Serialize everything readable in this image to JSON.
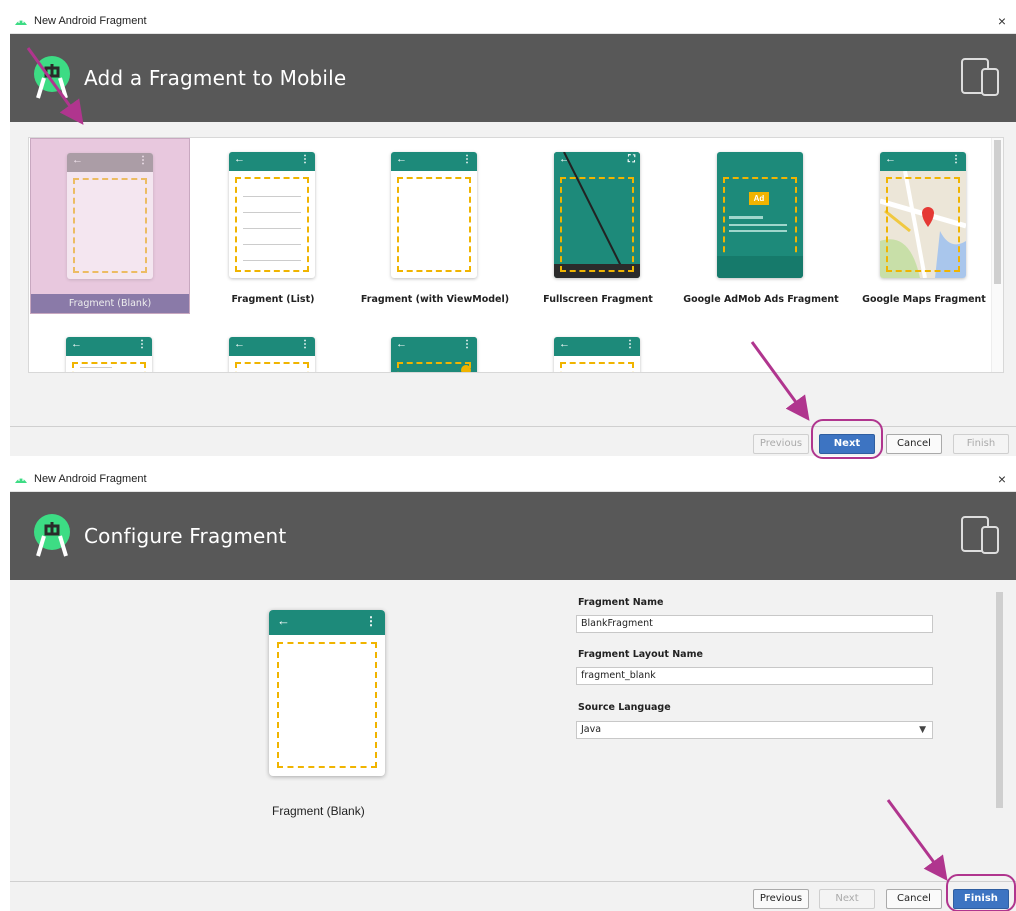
{
  "dialog1": {
    "window_title": "New Android Fragment",
    "close_glyph": "×",
    "banner_title": "Add a Fragment to Mobile",
    "templates": [
      {
        "label": "Fragment (Blank)",
        "selected": true
      },
      {
        "label": "Fragment (List)"
      },
      {
        "label": "Fragment (with ViewModel)"
      },
      {
        "label": "Fullscreen Fragment"
      },
      {
        "label": "Google AdMob Ads Fragment",
        "ad_text": "Ad"
      },
      {
        "label": "Google Maps Fragment"
      }
    ],
    "buttons": {
      "previous": "Previous",
      "next": "Next",
      "cancel": "Cancel",
      "finish": "Finish"
    }
  },
  "dialog2": {
    "window_title": "New Android Fragment",
    "close_glyph": "×",
    "banner_title": "Configure Fragment",
    "preview_caption": "Fragment (Blank)",
    "fields": {
      "name_label": "Fragment Name",
      "name_value": "BlankFragment",
      "layout_label": "Fragment Layout Name",
      "layout_value": "fragment_blank",
      "language_label": "Source Language",
      "language_value": "Java"
    },
    "buttons": {
      "previous": "Previous",
      "next": "Next",
      "cancel": "Cancel",
      "finish": "Finish"
    }
  },
  "colors": {
    "accent": "#b0358e",
    "primary_button": "#3d74c2",
    "phone_bar": "#1d8a7a",
    "dash": "#f0b400",
    "banner": "#585858"
  },
  "icons": [
    "android-icon",
    "android-studio-logo",
    "device-icon",
    "back-arrow-icon",
    "overflow-menu-icon",
    "dropdown-caret-icon"
  ]
}
